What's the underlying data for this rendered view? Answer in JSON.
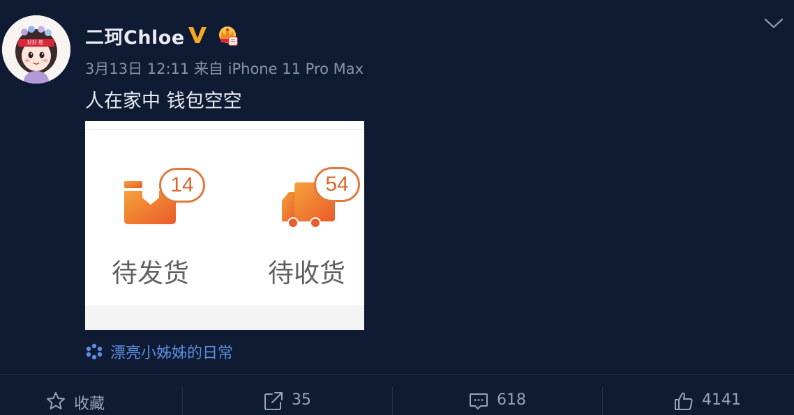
{
  "post": {
    "username": "二珂Chloe",
    "timestamp": "3月13日 12:11",
    "source_prefix": "来自",
    "device": "iPhone 11 Pro Max",
    "text": "人在家中 钱包空空",
    "badges": {
      "verified": "V",
      "verified_color": "#f5a623",
      "member_icon": "crown-icon"
    }
  },
  "photo": {
    "items": [
      {
        "label": "待发货",
        "count": "14",
        "icon": "package-box-icon"
      },
      {
        "label": "待收货",
        "count": "54",
        "icon": "delivery-truck-icon"
      }
    ],
    "accent_color": "#ef7b2c"
  },
  "topic": {
    "label": "漂亮小姊姊的日常",
    "icon": "topic-asterisk-icon",
    "color": "#5b8fe0"
  },
  "actions": {
    "favorite": {
      "label": "收藏",
      "icon": "star-icon"
    },
    "repost": {
      "count": "35",
      "icon": "share-icon"
    },
    "comment": {
      "count": "618",
      "icon": "comment-icon"
    },
    "like": {
      "count": "4141",
      "icon": "thumbs-up-icon"
    }
  },
  "avatar_caption": "好好 胜"
}
